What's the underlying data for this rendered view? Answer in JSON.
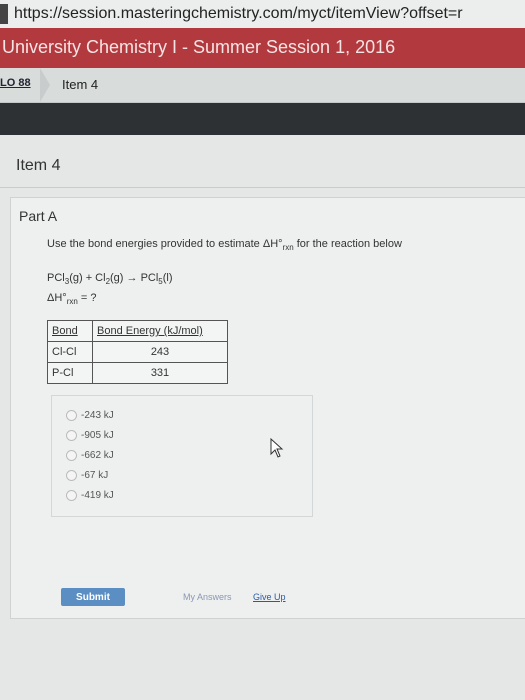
{
  "browser": {
    "url": "https://session.masteringchemistry.com/myct/itemView?offset=r"
  },
  "course": {
    "title": "University Chemistry I - Summer Session 1, 2016"
  },
  "breadcrumb": {
    "lo": "LO 88",
    "item": "Item 4"
  },
  "item": {
    "title": "Item 4"
  },
  "part": {
    "title": "Part A",
    "question_pre": "Use the bond energies provided to estimate ΔH°",
    "question_sub": "rxn",
    "question_post": " for the reaction below",
    "eq_pcl3": "PCl",
    "eq_sub3": "3",
    "eq_mid1": "(g) + Cl",
    "eq_sub2": "2",
    "eq_mid2": "(g) → PCl",
    "eq_sub5": "5",
    "eq_end": "(l)",
    "dh_label": "ΔH°",
    "dh_sub": "rxn",
    "dh_tail": " = ?"
  },
  "table": {
    "headers": [
      "Bond",
      "Bond Energy (kJ/mol)"
    ],
    "rows": [
      [
        "Cl-Cl",
        "243"
      ],
      [
        "P-Cl",
        "331"
      ]
    ]
  },
  "choices": [
    "-243 kJ",
    "-905 kJ",
    "-662 kJ",
    "-67 kJ",
    "-419 kJ"
  ],
  "actions": {
    "submit": "Submit",
    "my_answers": "My Answers",
    "give_up": "Give Up"
  }
}
